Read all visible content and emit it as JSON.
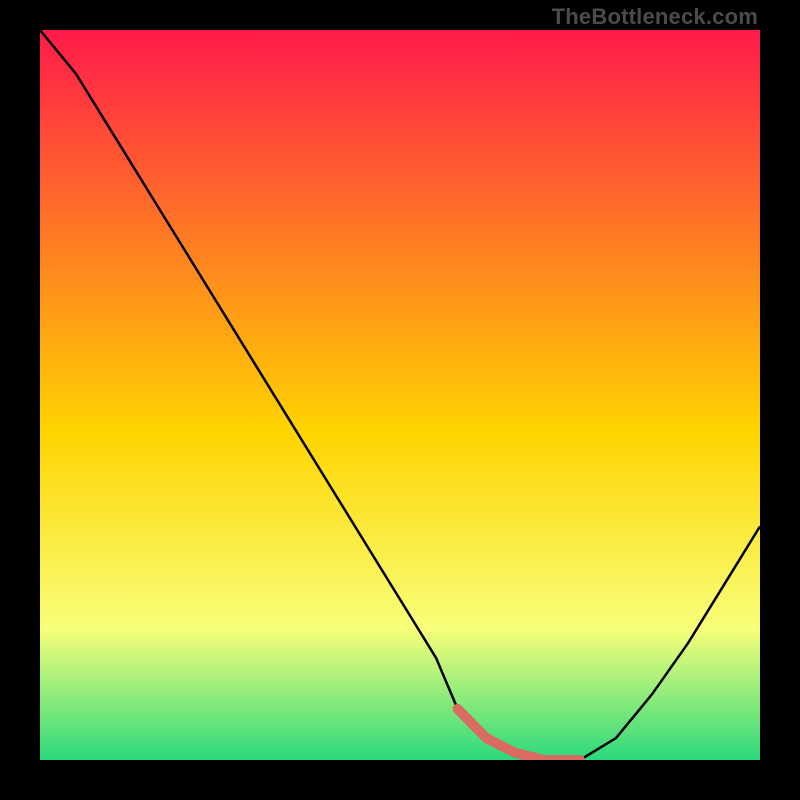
{
  "watermark": "TheBottleneck.com",
  "colors": {
    "bg": "#000000",
    "curve": "#000000",
    "highlight": "#d96b61",
    "grad_top": "#ff1a4a",
    "grad_mid": "#ffd400",
    "grad_low": "#f8ff7a",
    "grad_bottom": "#2bd97c"
  },
  "chart_data": {
    "type": "line",
    "title": "",
    "xlabel": "",
    "ylabel": "",
    "xlim": [
      0,
      100
    ],
    "ylim": [
      0,
      100
    ],
    "x": [
      0,
      5,
      10,
      15,
      20,
      25,
      30,
      35,
      40,
      45,
      50,
      55,
      58,
      62,
      66,
      70,
      73,
      75,
      80,
      85,
      90,
      95,
      100
    ],
    "values": [
      100,
      94,
      86,
      78,
      70,
      62,
      54,
      46,
      38,
      30,
      22,
      14,
      7,
      3,
      1,
      0,
      0,
      0,
      3,
      9,
      16,
      24,
      32
    ],
    "highlight_range_x": [
      58,
      75
    ],
    "note": "Bottleneck-style curve: steep descent from top-left to a flat minimum around x≈65–73, then a shallower rise toward the right. Background is a vertical red→yellow→green gradient. Values are read off the plot proportionally (0=bottom, 100=top)."
  }
}
